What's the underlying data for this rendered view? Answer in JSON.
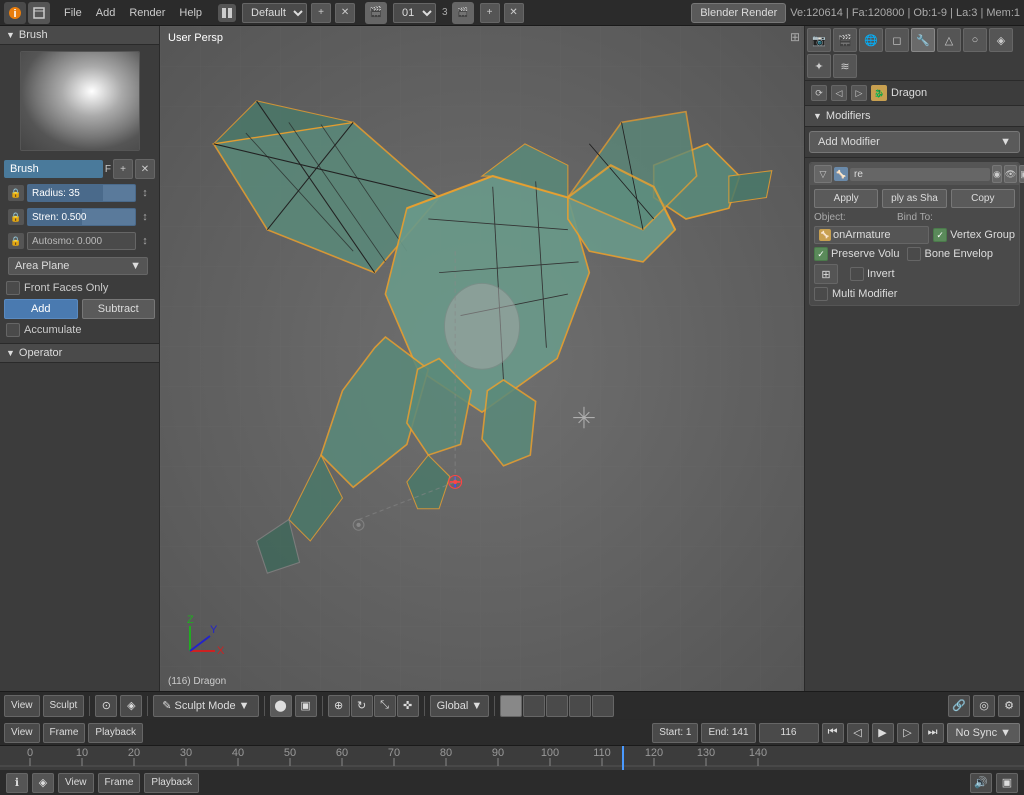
{
  "app": {
    "title": "Blender",
    "version": "Blender Render"
  },
  "top_bar": {
    "info_label": "i",
    "menus": [
      "File",
      "Add",
      "Render",
      "Help"
    ],
    "layout_label": "Default",
    "frame_current": "01",
    "scene_num": "3",
    "render_engine": "Blender Render",
    "stats": "Ve:120614 | Fa:120800 | Ob:1-9 | La:3 | Mem:1"
  },
  "left_panel": {
    "header": "Brush",
    "brush_name": "Brush",
    "f_label": "F",
    "radius_label": "Radius: 35",
    "strength_label": "Stren: 0.500",
    "autosmooth_label": "Autosmo: 0.000",
    "area_plane": "Area Plane",
    "front_faces_label": "Front Faces Only",
    "add_label": "Add",
    "subtract_label": "Subtract",
    "accumulate_label": "Accumulate",
    "operator_label": "Operator"
  },
  "viewport": {
    "label": "User Persp",
    "object_info": "(116) Dragon"
  },
  "right_panel": {
    "object_name": "Dragon",
    "modifiers_label": "Modifiers",
    "add_modifier_label": "Add Modifier",
    "modifier_name": "re",
    "apply_label": "Apply",
    "ply_as_sha_label": "ply as Sha",
    "copy_label": "Copy",
    "object_label": "Object:",
    "bind_to_label": "Bind To:",
    "on_armature_label": "onArmature",
    "vertex_group_label": "Vertex Group",
    "preserve_volu_label": "Preserve Volu",
    "bone_envelop_label": "Bone Envelop",
    "invert_label": "Invert",
    "multi_modifier_label": "Multi Modifier"
  },
  "viewport_toolbar": {
    "view_label": "View",
    "sculpt_label": "Sculpt",
    "mode_label": "Sculpt Mode",
    "global_label": "Global"
  },
  "timeline": {
    "view_label": "View",
    "frame_label": "Frame",
    "playback_label": "Playback",
    "start_label": "Start: 1",
    "end_label": "End: 141",
    "current_frame": "116",
    "no_sync_label": "No Sync",
    "ruler_marks": [
      "0",
      "10",
      "20",
      "30",
      "40",
      "50",
      "60",
      "70",
      "80",
      "90",
      "100",
      "110",
      "120",
      "130",
      "140"
    ]
  }
}
